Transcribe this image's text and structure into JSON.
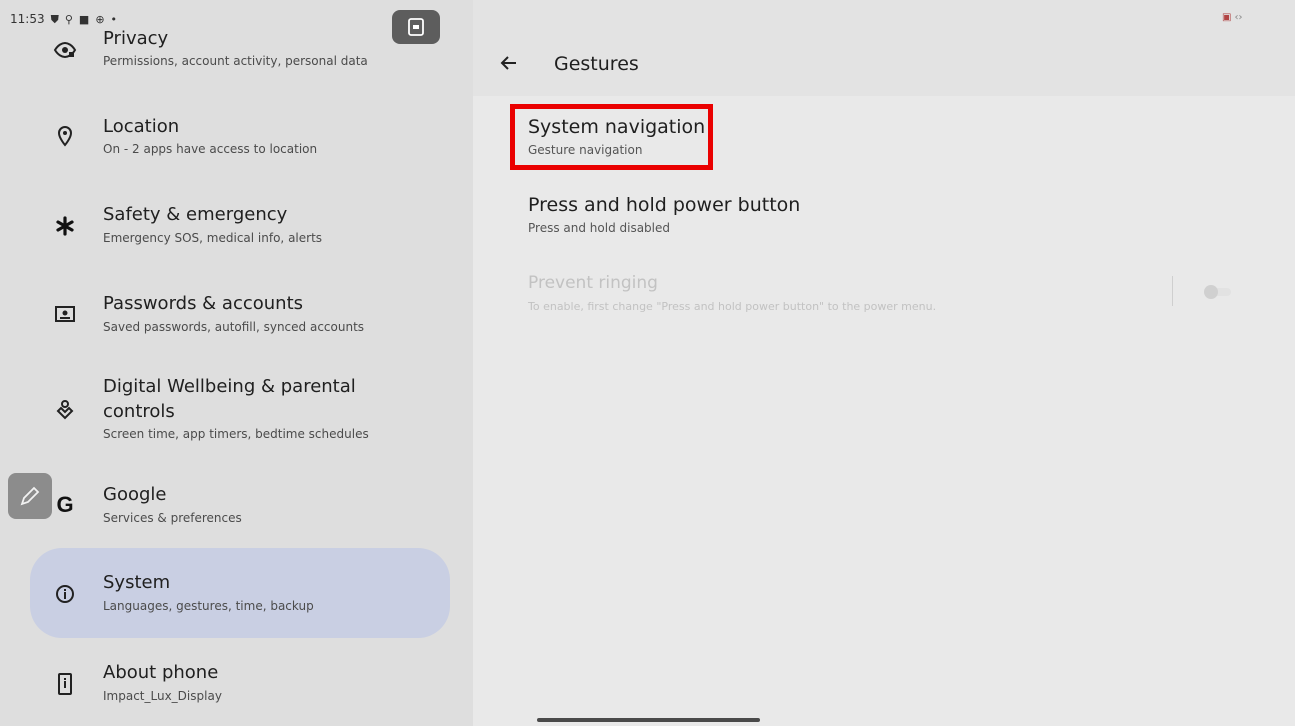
{
  "status_bar": {
    "time": "11:53",
    "icons": [
      "shield-icon",
      "usb-icon",
      "square-icon",
      "android-icon",
      "dot-icon"
    ]
  },
  "settings_list": [
    {
      "name": "privacy",
      "icon": "privacy-icon",
      "title": "Privacy",
      "subtitle": "Permissions, account activity, personal data"
    },
    {
      "name": "location",
      "icon": "location-pin-icon",
      "title": "Location",
      "subtitle": "On - 2 apps have access to location"
    },
    {
      "name": "safety",
      "icon": "asterisk-icon",
      "title": "Safety & emergency",
      "subtitle": "Emergency SOS, medical info, alerts"
    },
    {
      "name": "passwords",
      "icon": "account-card-icon",
      "title": "Passwords & accounts",
      "subtitle": "Saved passwords, autofill, synced accounts"
    },
    {
      "name": "wellbeing",
      "icon": "wellbeing-icon",
      "title": "Digital Wellbeing & parental",
      "title2": "controls",
      "subtitle": "Screen time, app timers, bedtime schedules"
    },
    {
      "name": "google",
      "icon": "google-g-icon",
      "title": "Google",
      "subtitle": "Services & preferences"
    },
    {
      "name": "system",
      "icon": "info-icon",
      "title": "System",
      "subtitle": "Languages, gestures, time, backup",
      "selected": true
    },
    {
      "name": "about",
      "icon": "phone-icon",
      "title": "About phone",
      "subtitle": "Impact_Lux_Display"
    }
  ],
  "gestures_page": {
    "title": "Gestures",
    "items": [
      {
        "title": "System navigation",
        "subtitle": "Gesture navigation"
      },
      {
        "title": "Press and hold power button",
        "subtitle": "Press and hold disabled"
      },
      {
        "title": "Prevent ringing",
        "subtitle": "To enable, first change \"Press and hold power button\" to the power menu.",
        "enabled": false,
        "toggle_on": false
      }
    ]
  },
  "colors": {
    "selected_bg": "#c9cfe3",
    "highlight_border": "#ea0000"
  }
}
